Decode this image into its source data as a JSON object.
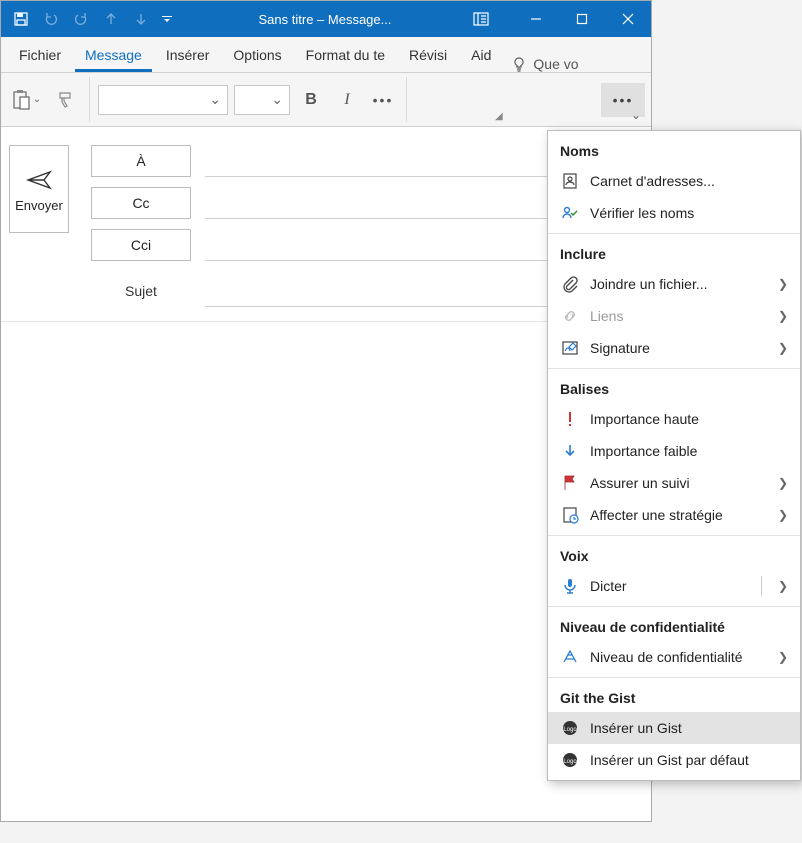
{
  "titlebar": {
    "title": "Sans titre – Message..."
  },
  "tabs": {
    "fichier": "Fichier",
    "message": "Message",
    "inserer": "Insérer",
    "options": "Options",
    "format": "Format du te",
    "revision": "Révisi",
    "aide": "Aid",
    "tell_me": "Que vo"
  },
  "format_buttons": {
    "bold": "B",
    "italic": "I"
  },
  "compose": {
    "send": "Envoyer",
    "to": "À",
    "cc": "Cc",
    "bcc": "Cci",
    "subject": "Sujet"
  },
  "dropdown": {
    "sections": [
      {
        "title": "Noms",
        "items": [
          {
            "icon": "address-book",
            "label": "Carnet d'adresses...",
            "submenu": false
          },
          {
            "icon": "check-names",
            "label": "Vérifier les noms",
            "submenu": false
          }
        ]
      },
      {
        "title": "Inclure",
        "items": [
          {
            "icon": "attach",
            "label": "Joindre un fichier...",
            "submenu": true
          },
          {
            "icon": "link",
            "label": "Liens",
            "submenu": true,
            "disabled": true
          },
          {
            "icon": "signature",
            "label": "Signature",
            "submenu": true
          }
        ]
      },
      {
        "title": "Balises",
        "items": [
          {
            "icon": "importance-high",
            "label": "Importance haute",
            "submenu": false
          },
          {
            "icon": "importance-low",
            "label": "Importance faible",
            "submenu": false
          },
          {
            "icon": "follow-up",
            "label": "Assurer un suivi",
            "submenu": true
          },
          {
            "icon": "policy",
            "label": "Affecter une stratégie",
            "submenu": true
          }
        ]
      },
      {
        "title": "Voix",
        "items": [
          {
            "icon": "dictate",
            "label": "Dicter",
            "submenu": true,
            "split": true
          }
        ]
      },
      {
        "title": "Niveau de confidentialité",
        "items": [
          {
            "icon": "sensitivity",
            "label": "Niveau de confidentialité",
            "submenu": true
          }
        ]
      },
      {
        "title": "Git the Gist",
        "items": [
          {
            "icon": "logo",
            "label": "Insérer un Gist",
            "submenu": false,
            "selected": true
          },
          {
            "icon": "logo",
            "label": "Insérer un Gist par défaut",
            "submenu": false
          }
        ]
      }
    ]
  }
}
